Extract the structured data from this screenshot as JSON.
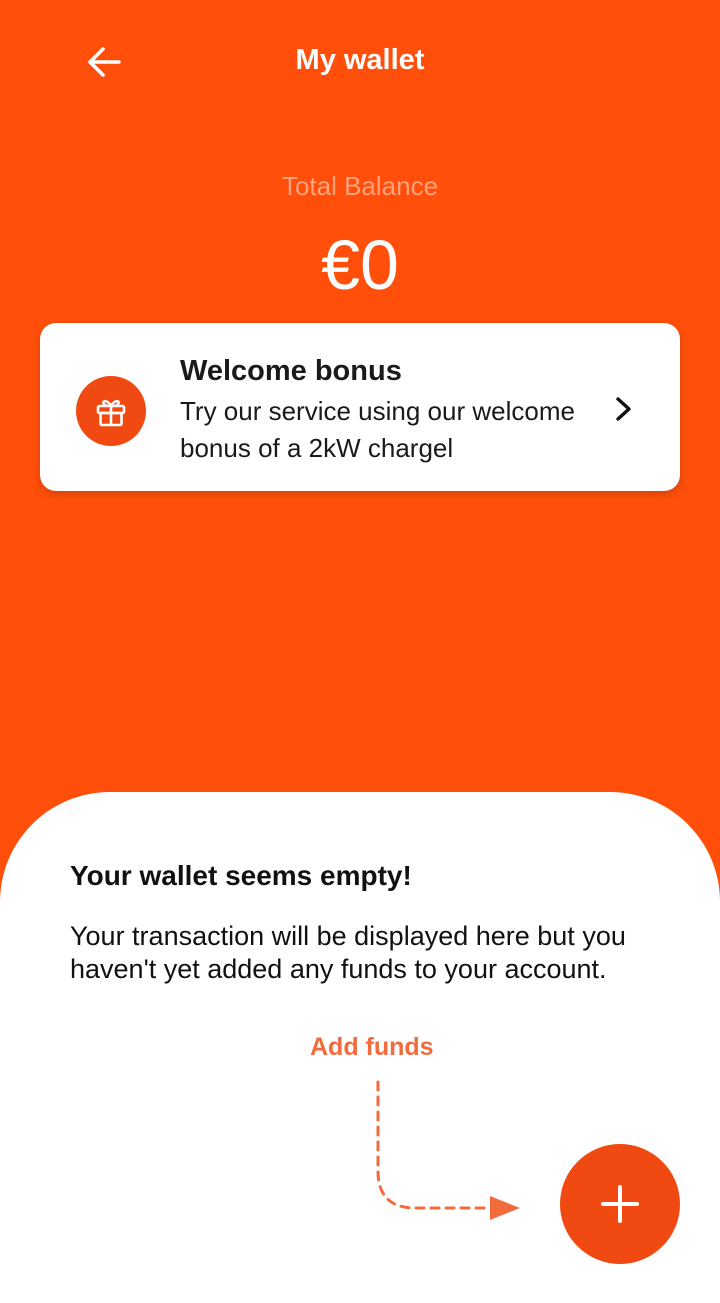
{
  "header": {
    "title": "My wallet",
    "back_icon": "arrow-left-icon"
  },
  "balance": {
    "label": "Total Balance",
    "value": "€0"
  },
  "bonus_card": {
    "title": "Welcome bonus",
    "description": "Try our service using our welcome bonus of a 2kW chargel",
    "icon": "gift-icon",
    "chevron_icon": "chevron-right-icon"
  },
  "empty_state": {
    "title": "Your wallet seems empty!",
    "description": "Your transaction will be displayed here but you haven't yet added any funds to your account."
  },
  "add_funds": {
    "label": "Add funds",
    "button_icon": "plus-icon"
  },
  "colors": {
    "brand": "#FF4F0A",
    "accent": "#F04A12",
    "muted_label": "#FFA27D"
  }
}
